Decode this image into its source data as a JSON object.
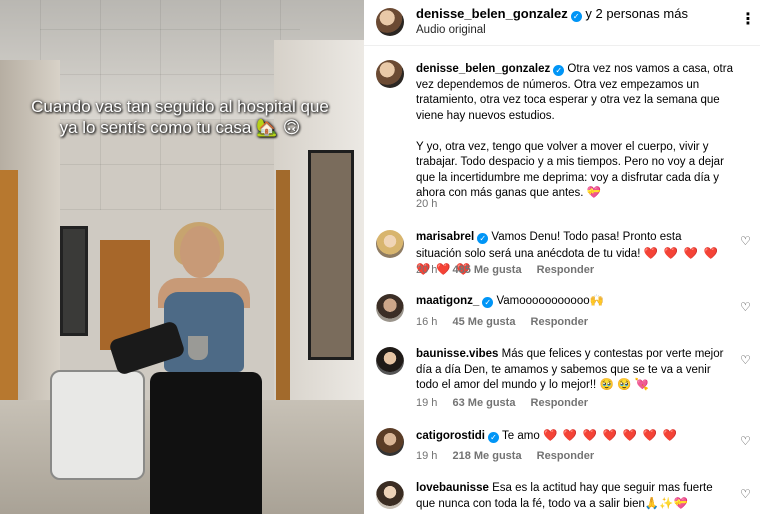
{
  "media": {
    "overlay_text": "Cuando vas tan seguido al hospital que ya lo sentís como tu casa",
    "overlay_emoji": "🏡 🙃"
  },
  "header": {
    "username": "denisse_belen_gonzalez",
    "others": "y 2 personas más",
    "audio": "Audio original",
    "more_icon": "more-options-icon"
  },
  "caption": {
    "username": "denisse_belen_gonzalez",
    "paragraph1": "Otra vez nos vamos a casa, otra vez dependemos de números. Otra vez empezamos un tratamiento, otra vez toca esperar y otra vez la semana que viene hay nuevos estudios.",
    "paragraph2": "Y yo, otra vez, tengo que volver a mover el cuerpo, vivir y trabajar. Todo despacio y a mis tiempos. Pero no voy a dejar que la incertidumbre me deprima: voy a disfrutar cada día y ahora con más ganas que antes. 💝",
    "time": "20 h"
  },
  "comments": [
    {
      "username": "marisabrel",
      "verified": true,
      "text": "Vamos Denu! Todo pasa! Pronto esta situación solo será una anécdota de tu vida!",
      "emojis": "❤️ ❤️ ❤️ ❤️ ❤️ ❤️ ❤️",
      "time": "20 h",
      "likes": "485 Me gusta",
      "reply": "Responder"
    },
    {
      "username": "maatigonz_",
      "verified": true,
      "text": "Vamooooooooooo🙌",
      "emojis": "",
      "time": "16 h",
      "likes": "45 Me gusta",
      "reply": "Responder"
    },
    {
      "username": "baunisse.vibes",
      "verified": false,
      "text": "Más que felices y contestas por verte mejor día a día Den, te amamos y sabemos que se te va a venir todo el amor del mundo y lo mejor!! 🥹 🥹 💘",
      "emojis": "",
      "time": "19 h",
      "likes": "63 Me gusta",
      "reply": "Responder"
    },
    {
      "username": "catigorostidi",
      "verified": true,
      "text": "Te amo",
      "emojis": "❤️ ❤️ ❤️ ❤️ ❤️ ❤️ ❤️",
      "time": "19 h",
      "likes": "218 Me gusta",
      "reply": "Responder"
    },
    {
      "username": "lovebaunisse",
      "verified": false,
      "text": "Esa es la actitud hay que seguir mas fuerte que nunca con toda la fé, todo va a salir bien🙏✨💝",
      "emojis": "",
      "time": "",
      "likes": "",
      "reply": ""
    }
  ]
}
